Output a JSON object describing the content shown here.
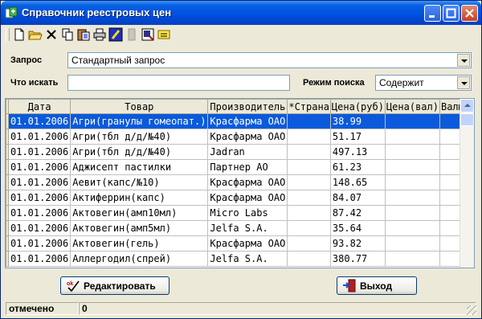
{
  "window": {
    "title": "Справочник реестровых цен"
  },
  "toolbar": {
    "icons": [
      "new-file-icon",
      "open-folder-icon",
      "delete-icon",
      "copy-icon",
      "paste-icon",
      "print-icon",
      "edit-icon",
      "disabled-icon",
      "import-icon",
      "note-icon"
    ]
  },
  "query": {
    "label": "Запрос",
    "value": "Стандартный запрос"
  },
  "search": {
    "label": "Что искать",
    "value": ""
  },
  "search_mode": {
    "label": "Режим поиска",
    "value": "Содержит"
  },
  "grid": {
    "columns": [
      "Дата",
      "Товар",
      "Производитель",
      "*Страна",
      "Цена(руб)",
      "Цена(вал)",
      "Валюта"
    ],
    "rows": [
      [
        "01.01.2006",
        "Агри(гранулы гомеопат.)",
        "Красфарма ОАО",
        "",
        "38.99",
        "",
        ""
      ],
      [
        "01.01.2006",
        "Агри(тбл д/д/№40)",
        "Красфарма ОАО",
        "",
        "51.17",
        "",
        ""
      ],
      [
        "01.01.2006",
        "Агри(тбл д/д/№40)",
        "Jadran",
        "",
        "497.13",
        "",
        ""
      ],
      [
        "01.01.2006",
        "Аджисепт пастилки",
        "Партнер АО",
        "",
        "61.23",
        "",
        ""
      ],
      [
        "01.01.2006",
        "Аевит(капс/№10)",
        "Красфарма ОАО",
        "",
        "148.65",
        "",
        ""
      ],
      [
        "01.01.2006",
        "Актиферрин(капс)",
        "Красфарма ОАО",
        "",
        "84.07",
        "",
        ""
      ],
      [
        "01.01.2006",
        "Актовегин(амп10мл)",
        "Micro Labs",
        "",
        "87.42",
        "",
        ""
      ],
      [
        "01.01.2006",
        "Актовегин(амп5мл)",
        "Jelfa S.A.",
        "",
        "35.64",
        "",
        ""
      ],
      [
        "01.01.2006",
        "Актовегин(гель)",
        "Красфарма ОАО",
        "",
        "93.82",
        "",
        ""
      ],
      [
        "01.01.2006",
        "Аллергодил(спрей)",
        "Jelfa S.A.",
        "",
        "380.77",
        "",
        ""
      ]
    ]
  },
  "buttons": {
    "edit_label": "Редактировать",
    "exit_label": "Выход"
  },
  "status": {
    "marked_label": "отмечено",
    "marked_count": "0"
  },
  "colors": {
    "selection": "#0A5ADB",
    "titlebar": "#0055E5"
  }
}
